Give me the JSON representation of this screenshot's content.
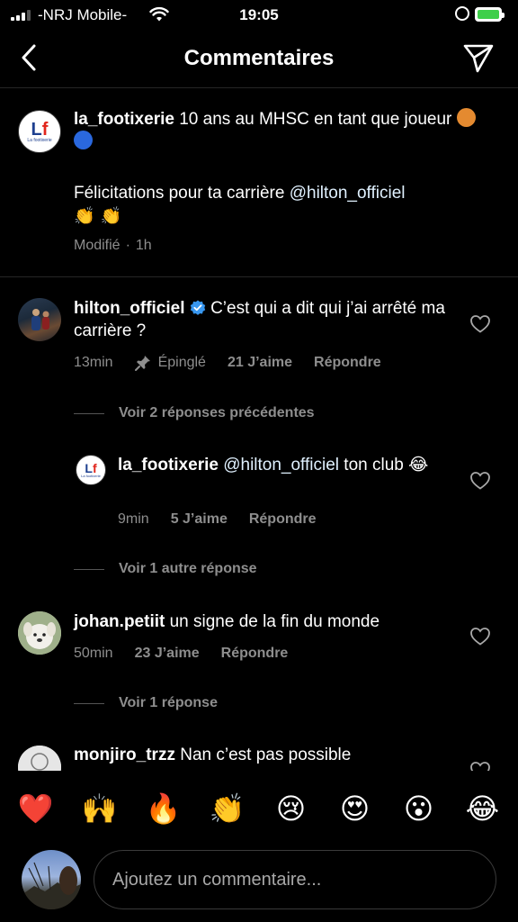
{
  "status_bar": {
    "carrier": "-NRJ Mobile-",
    "time": "19:05"
  },
  "header": {
    "title": "Commentaires",
    "back_icon": "chevron-left-icon",
    "send_icon": "paper-plane-icon"
  },
  "caption": {
    "username": "la_footixerie",
    "text": "10 ans au MHSC en tant que joueur",
    "line2_prefix": "Félicitations pour ta carrière ",
    "line2_mention": "@hilton_officiel",
    "line3": "👏 👏",
    "edited": "Modifié",
    "time": "1h"
  },
  "comments": [
    {
      "username": "hilton_officiel",
      "verified": true,
      "text": "C’est qui a dit qui j’ai arrêté ma carrière ?",
      "time": "13min",
      "pinned": "Épinglé",
      "likes": "21 J’aime",
      "reply": "Répondre",
      "view_replies": "Voir 2 réponses précédentes"
    },
    {
      "username": "la_footixerie",
      "mention": "@hilton_officiel",
      "text_after": "ton club",
      "emoji": "😂",
      "time": "9min",
      "likes": "5 J’aime",
      "reply": "Répondre",
      "view_replies": "Voir 1 autre réponse"
    },
    {
      "username": "johan.petiit",
      "text": "un signe de la fin du monde",
      "time": "50min",
      "likes": "23 J’aime",
      "reply": "Répondre",
      "view_replies": "Voir 1 réponse"
    },
    {
      "username": "monjiro_trzz",
      "text": "Nan c’est pas possible"
    }
  ],
  "reactions": [
    "❤️",
    "🙌",
    "🔥",
    "👏",
    "😢",
    "😍",
    "😮",
    "😂"
  ],
  "comment_input": {
    "placeholder": "Ajoutez un commentaire..."
  },
  "logo": {
    "lf_l": "L",
    "lf_f": "f",
    "sub": "La footixerie"
  },
  "colors": {
    "background": "#000000",
    "secondary_text": "#8e8e8e",
    "mention": "#e0f1ff",
    "verified": "#3897f0",
    "battery": "#3ecf4a"
  }
}
